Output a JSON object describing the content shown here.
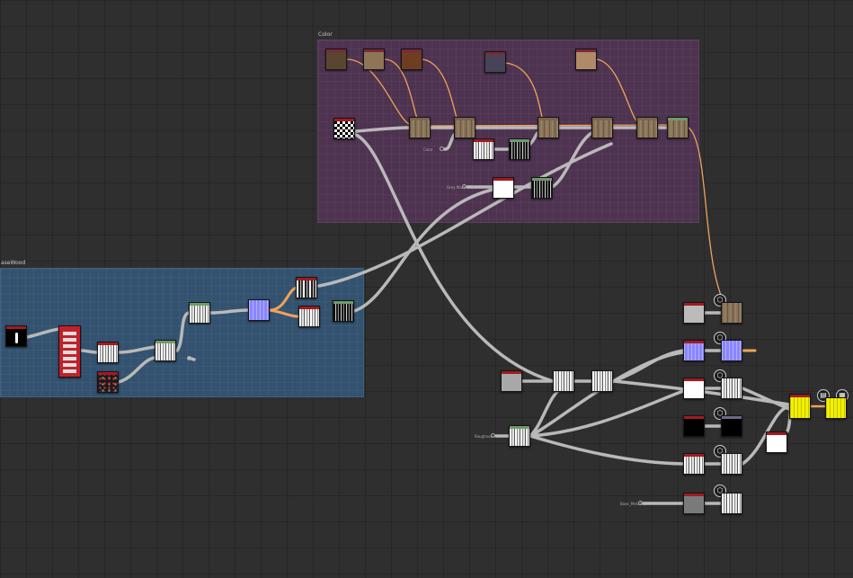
{
  "frames": {
    "color_title": "Color",
    "wood_title": "aseWood"
  },
  "param_labels": {
    "color_input": "Color",
    "wood_output": "",
    "color_small": "Grey Mask",
    "bottom_a": "Roughness",
    "bottom_b": "Base_Metallic"
  },
  "icons": {
    "output": "output-cube-icon",
    "file": "file-icon",
    "checker": "checker-icon"
  },
  "colors": {
    "wire": "#b9b9b9",
    "wire_orange": "#f0a35a",
    "frame_color": "#4e3350",
    "frame_wood": "#33526f",
    "node_header_red": "#a11b22",
    "node_header_green": "#6f9b6a"
  }
}
